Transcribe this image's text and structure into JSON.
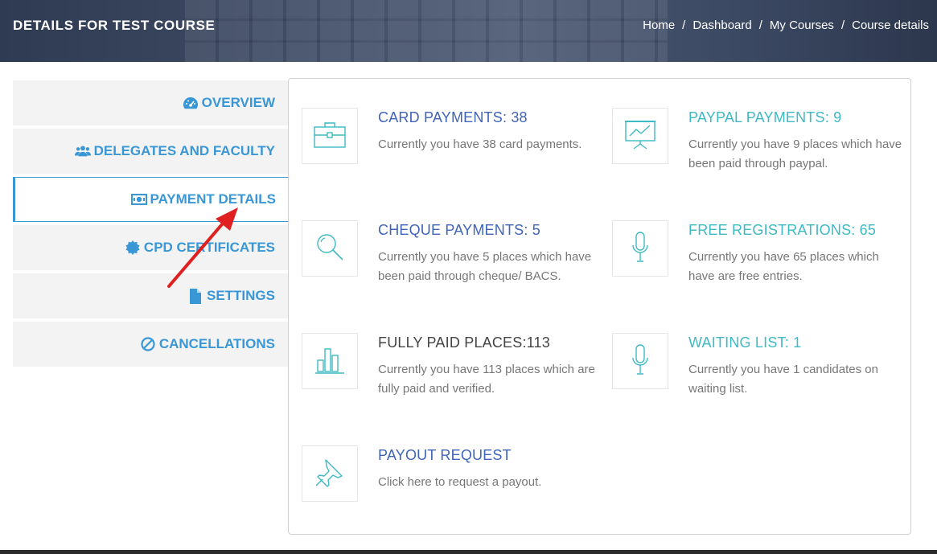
{
  "header": {
    "title": "DETAILS FOR TEST COURSE",
    "breadcrumb": [
      "Home",
      "Dashboard",
      "My Courses",
      "Course details"
    ],
    "separator": "/"
  },
  "sidebar": {
    "items": [
      {
        "label": "OVERVIEW",
        "icon": "dashboard-icon"
      },
      {
        "label": "DELEGATES AND FACULTY",
        "icon": "users-icon"
      },
      {
        "label": "PAYMENT DETAILS",
        "icon": "money-icon",
        "active": true
      },
      {
        "label": "CPD CERTIFICATES",
        "icon": "certificate-icon"
      },
      {
        "label": "SETTINGS",
        "icon": "file-icon"
      },
      {
        "label": "CANCELLATIONS",
        "icon": "ban-icon"
      }
    ]
  },
  "cards": [
    {
      "title": "CARD PAYMENTS: 38",
      "desc": "Currently you have 38 card payments.",
      "icon": "briefcase-icon",
      "color": "#3f64b8"
    },
    {
      "title": "PAYPAL PAYMENTS: 9",
      "desc": "Currently you have 9 places which have been paid through paypal.",
      "icon": "presentation-chart-icon",
      "color": "#3fb9c3"
    },
    {
      "title": "CHEQUE PAYMENTS: 5",
      "desc": "Currently you have 5 places which have been paid through cheque/ BACS.",
      "icon": "magnifier-icon",
      "color": "#3f64b8"
    },
    {
      "title": "FREE REGISTRATIONS: 65",
      "desc": "Currently you have 65 places which have are free entries.",
      "icon": "microphone-icon",
      "color": "#3fb9c3"
    },
    {
      "title": "FULLY PAID PLACES:113",
      "desc": "Currently you have 113 places which are fully paid and verified.",
      "icon": "bar-chart-icon",
      "color": "#444444"
    },
    {
      "title": "WAITING LIST: 1",
      "desc": "Currently you have 1 candidates on waiting list.",
      "icon": "microphone-icon",
      "color": "#3fb9c3"
    },
    {
      "title": "PAYOUT REQUEST",
      "desc": "Click here to request a payout.",
      "icon": "pin-icon",
      "color": "#3f64b8"
    }
  ],
  "colors": {
    "accent": "#3a97d6",
    "icon_stroke": "#3fb9c3",
    "annotation_arrow": "#e02020"
  }
}
